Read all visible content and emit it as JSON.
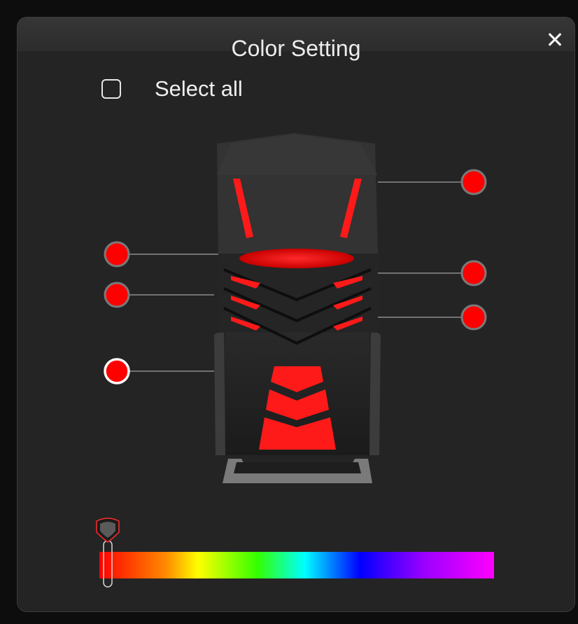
{
  "dialog": {
    "title": "Color Setting",
    "close_glyph": "✕",
    "close_icon": "close-icon"
  },
  "select_all": {
    "label": "Select all",
    "checked": false
  },
  "zones": {
    "selected_color": "#ff0000",
    "items": [
      {
        "name": "zone-top-right",
        "color": "#ff0000",
        "selected": false
      },
      {
        "name": "zone-left-1",
        "color": "#ff0000",
        "selected": false
      },
      {
        "name": "zone-left-2",
        "color": "#ff0000",
        "selected": false
      },
      {
        "name": "zone-left-3",
        "color": "#ff0000",
        "selected": true
      },
      {
        "name": "zone-right-1",
        "color": "#ff0000",
        "selected": false
      },
      {
        "name": "zone-right-2",
        "color": "#ff0000",
        "selected": false
      }
    ]
  },
  "color_slider": {
    "value": 0,
    "thumb_icon": "slider-thumb-icon"
  },
  "colors": {
    "background": "#242424",
    "accent": "#ff0000",
    "text": "#ececec"
  }
}
